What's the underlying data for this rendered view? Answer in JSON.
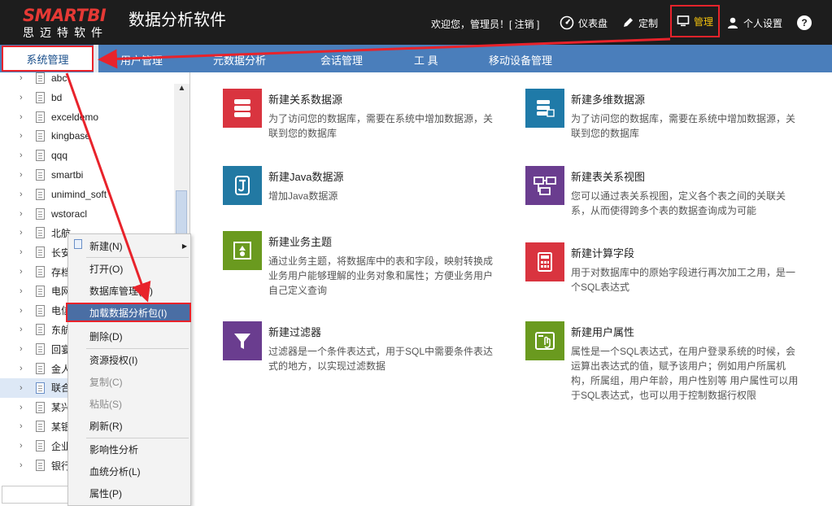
{
  "header": {
    "logo_main": "SMARTBI",
    "logo_sub": "思迈特软件",
    "app_title": "数据分析软件",
    "welcome": "欢迎您，管理员！[ 注销 ]",
    "dashboard_label": "仪表盘",
    "custom_label": "定制",
    "manage_label": "管理",
    "personal_label": "个人设置",
    "help_label": "?"
  },
  "nav": {
    "active": "系统管理",
    "items": [
      "用户管理",
      "元数据分析",
      "会话管理",
      "工 具",
      "移动设备管理"
    ]
  },
  "tree": {
    "items": [
      "abc",
      "bd",
      "exceldemo",
      "kingbase",
      "qqq",
      "smartbi",
      "unimind_soft",
      "wstoracl",
      "北航",
      "长安",
      "存档",
      "电网",
      "电信",
      "东航",
      "回宴",
      "金人",
      "联合",
      "某兴",
      "某银",
      "企业",
      "银行"
    ],
    "selected_index": 16
  },
  "context_menu": {
    "items": [
      "新建(N)",
      "打开(O)",
      "数据库管理(M)",
      "加载数据分析包(I)",
      "删除(D)",
      "资源授权(I)",
      "复制(C)",
      "粘贴(S)",
      "刷新(R)",
      "影响性分析",
      "血统分析(L)",
      "属性(P)"
    ]
  },
  "cards": [
    {
      "title": "新建关系数据源",
      "desc": "为了访问您的数据库，需要在系统中增加数据源，关联到您的数据库",
      "color": "#d9343f",
      "icon": "database-icon"
    },
    {
      "title": "新建多维数据源",
      "desc": "为了访问您的数据库，需要在系统中增加数据源，关联到您的数据库",
      "color": "#1f7aa8",
      "icon": "cube-database-icon"
    },
    {
      "title": "新建Java数据源",
      "desc": "增加Java数据源",
      "color": "#2279a3",
      "icon": "java-icon"
    },
    {
      "title": "新建表关系视图",
      "desc": "您可以通过表关系视图，定义各个表之间的关联关系，从而使得跨多个表的数据查询成为可能",
      "color": "#6a3d8f",
      "icon": "table-relation-icon"
    },
    {
      "title": "新建业务主题",
      "desc": "通过业务主题，将数据库中的表和字段，映射转换成业务用户能够理解的业务对象和属性；方便业务用户自己定义查询",
      "color": "#6a9a1f",
      "icon": "business-theme-icon"
    },
    {
      "title": "新建计算字段",
      "desc": "用于对数据库中的原始字段进行再次加工之用，是一个SQL表达式",
      "color": "#d9343f",
      "icon": "calculator-icon"
    },
    {
      "title": "新建过滤器",
      "desc": "过滤器是一个条件表达式，用于SQL中需要条件表达式的地方，以实现过滤数据",
      "color": "#6a3d8f",
      "icon": "filter-icon"
    },
    {
      "title": "新建用户属性",
      "desc": "属性是一个SQL表达式，在用户登录系统的时候，会运算出表达式的值，赋予该用户；例如用户所属机构，所属组，用户年龄，用户性别等 用户属性可以用于SQL表达式，也可以用于控制数据行权限",
      "color": "#6a9a1f",
      "icon": "user-attribute-icon"
    }
  ]
}
